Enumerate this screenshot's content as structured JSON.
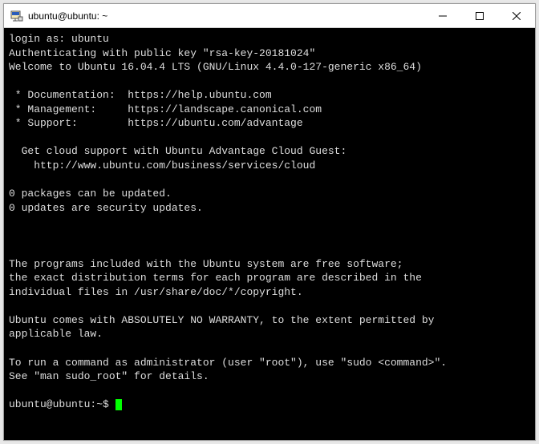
{
  "window": {
    "title": "ubuntu@ubuntu: ~"
  },
  "terminal": {
    "lines": [
      "login as: ubuntu",
      "Authenticating with public key \"rsa-key-20181024\"",
      "Welcome to Ubuntu 16.04.4 LTS (GNU/Linux 4.4.0-127-generic x86_64)",
      "",
      " * Documentation:  https://help.ubuntu.com",
      " * Management:     https://landscape.canonical.com",
      " * Support:        https://ubuntu.com/advantage",
      "",
      "  Get cloud support with Ubuntu Advantage Cloud Guest:",
      "    http://www.ubuntu.com/business/services/cloud",
      "",
      "0 packages can be updated.",
      "0 updates are security updates.",
      "",
      "",
      "",
      "The programs included with the Ubuntu system are free software;",
      "the exact distribution terms for each program are described in the",
      "individual files in /usr/share/doc/*/copyright.",
      "",
      "Ubuntu comes with ABSOLUTELY NO WARRANTY, to the extent permitted by",
      "applicable law.",
      "",
      "To run a command as administrator (user \"root\"), use \"sudo <command>\".",
      "See \"man sudo_root\" for details.",
      ""
    ],
    "prompt": "ubuntu@ubuntu:~$ "
  }
}
